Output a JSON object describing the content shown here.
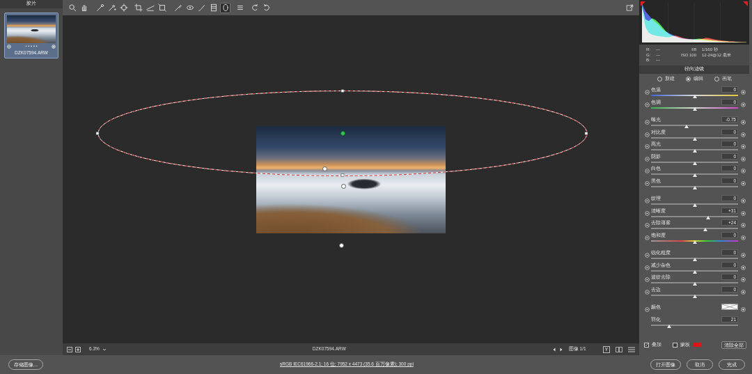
{
  "filmstrip": {
    "title": "胶片",
    "items": [
      {
        "filename": "DZK07594.ARW",
        "stars": "• • • • •",
        "selected": true
      }
    ]
  },
  "toolbar": {
    "tools": [
      {
        "selected": false
      },
      {
        "selected": false
      },
      {
        "selected": false
      },
      {
        "selected": false
      },
      {
        "selected": false
      },
      {
        "selected": false
      },
      {
        "selected": false
      },
      {
        "selected": false
      },
      {
        "selected": false
      },
      {
        "selected": false
      },
      {
        "selected": false
      },
      {
        "selected": false
      },
      {
        "selected": true
      },
      {
        "selected": false
      },
      {
        "selected": false
      },
      {
        "selected": false
      }
    ]
  },
  "canvas": {
    "pins": [
      {
        "selected": true
      },
      {
        "selected": false
      },
      {
        "selected": false
      },
      {
        "selected": false
      }
    ]
  },
  "status_bar": {
    "zoom": "6.3%",
    "filename": "DZK07594.ARW",
    "image_nav": "图像 1/1",
    "before_after": "Y"
  },
  "histogram": {
    "series": [
      {
        "name": "red",
        "color": "#ff3b3b",
        "values": [
          90,
          40,
          25,
          20,
          18,
          16,
          15,
          14,
          14,
          16,
          18,
          15,
          12,
          10,
          9,
          8,
          7,
          8,
          10,
          12,
          11,
          9,
          7,
          6,
          5,
          4,
          3,
          3,
          2,
          2,
          1,
          1
        ]
      },
      {
        "name": "green",
        "color": "#3bff3b",
        "values": [
          95,
          60,
          55,
          62,
          58,
          50,
          40,
          30,
          22,
          18,
          15,
          12,
          10,
          9,
          8,
          8,
          9,
          10,
          9,
          8,
          7,
          6,
          5,
          4,
          3,
          3,
          2,
          2,
          2,
          1,
          1,
          1
        ]
      },
      {
        "name": "blue",
        "color": "#3b5bff",
        "values": [
          100,
          80,
          70,
          60,
          52,
          45,
          35,
          28,
          24,
          20,
          16,
          13,
          11,
          10,
          9,
          8,
          8,
          7,
          6,
          5,
          4,
          3,
          3,
          2,
          2,
          1,
          1,
          1,
          1,
          0,
          0,
          0
        ]
      }
    ]
  },
  "info": {
    "rgb": [
      {
        "label": "R:",
        "value": "---"
      },
      {
        "label": "G:",
        "value": "---"
      },
      {
        "label": "B:",
        "value": "---"
      }
    ],
    "camera": [
      [
        "f/8",
        "1/160 秒"
      ],
      [
        "ISO 100",
        "12-24@12 毫米"
      ]
    ]
  },
  "panel": {
    "title": "径向滤镜",
    "modes": [
      {
        "label": "新建",
        "selected": false
      },
      {
        "label": "编辑",
        "selected": true
      },
      {
        "label": "画笔",
        "selected": false
      }
    ],
    "groups": [
      [
        {
          "label": "色温",
          "value": "0",
          "level": 0.5,
          "kind": "temperature"
        },
        {
          "label": "色调",
          "value": "0",
          "level": 0.5,
          "kind": "tint"
        }
      ],
      [
        {
          "label": "曝光",
          "value": "-0.75",
          "level": 0.41,
          "kind": "plain"
        },
        {
          "label": "对比度",
          "value": "0",
          "level": 0.5,
          "kind": "plain"
        },
        {
          "label": "高光",
          "value": "0",
          "level": 0.5,
          "kind": "plain"
        },
        {
          "label": "阴影",
          "value": "0",
          "level": 0.5,
          "kind": "plain"
        },
        {
          "label": "白色",
          "value": "0",
          "level": 0.5,
          "kind": "plain"
        },
        {
          "label": "黑色",
          "value": "0",
          "level": 0.5,
          "kind": "plain"
        }
      ],
      [
        {
          "label": "纹理",
          "value": "0",
          "level": 0.5,
          "kind": "plain"
        },
        {
          "label": "清晰度",
          "value": "+31",
          "level": 0.655,
          "kind": "plain"
        },
        {
          "label": "去除薄雾",
          "value": "+24",
          "level": 0.62,
          "kind": "plain"
        },
        {
          "label": "饱和度",
          "value": "0",
          "level": 0.5,
          "kind": "saturation"
        }
      ],
      [
        {
          "label": "锐化程度",
          "value": "0",
          "level": 0.5,
          "kind": "plain"
        },
        {
          "label": "减少杂色",
          "value": "0",
          "level": 0.5,
          "kind": "plain"
        },
        {
          "label": "波纹去除",
          "value": "0",
          "level": 0.5,
          "kind": "plain"
        },
        {
          "label": "去边",
          "value": "0",
          "level": 0.5,
          "kind": "plain"
        }
      ],
      [
        {
          "label": "颜色",
          "kind": "color",
          "set": false
        },
        {
          "label": "羽化",
          "value": "21",
          "level": 0.21,
          "kind": "feather"
        }
      ]
    ]
  },
  "overlay": {
    "label": "叠加",
    "checked": true
  },
  "mask": {
    "label": "蒙板",
    "checked": false,
    "color": "#e01414"
  },
  "clear_button": "清除全部",
  "footer": {
    "save": "存储图像...",
    "workflow": "sRGB IEC61966-2.1; 16 位; 7952 x 4473 (35.6 百万像素); 300 ppi",
    "buttons": [
      "打开图像",
      "取消",
      "完成"
    ]
  }
}
